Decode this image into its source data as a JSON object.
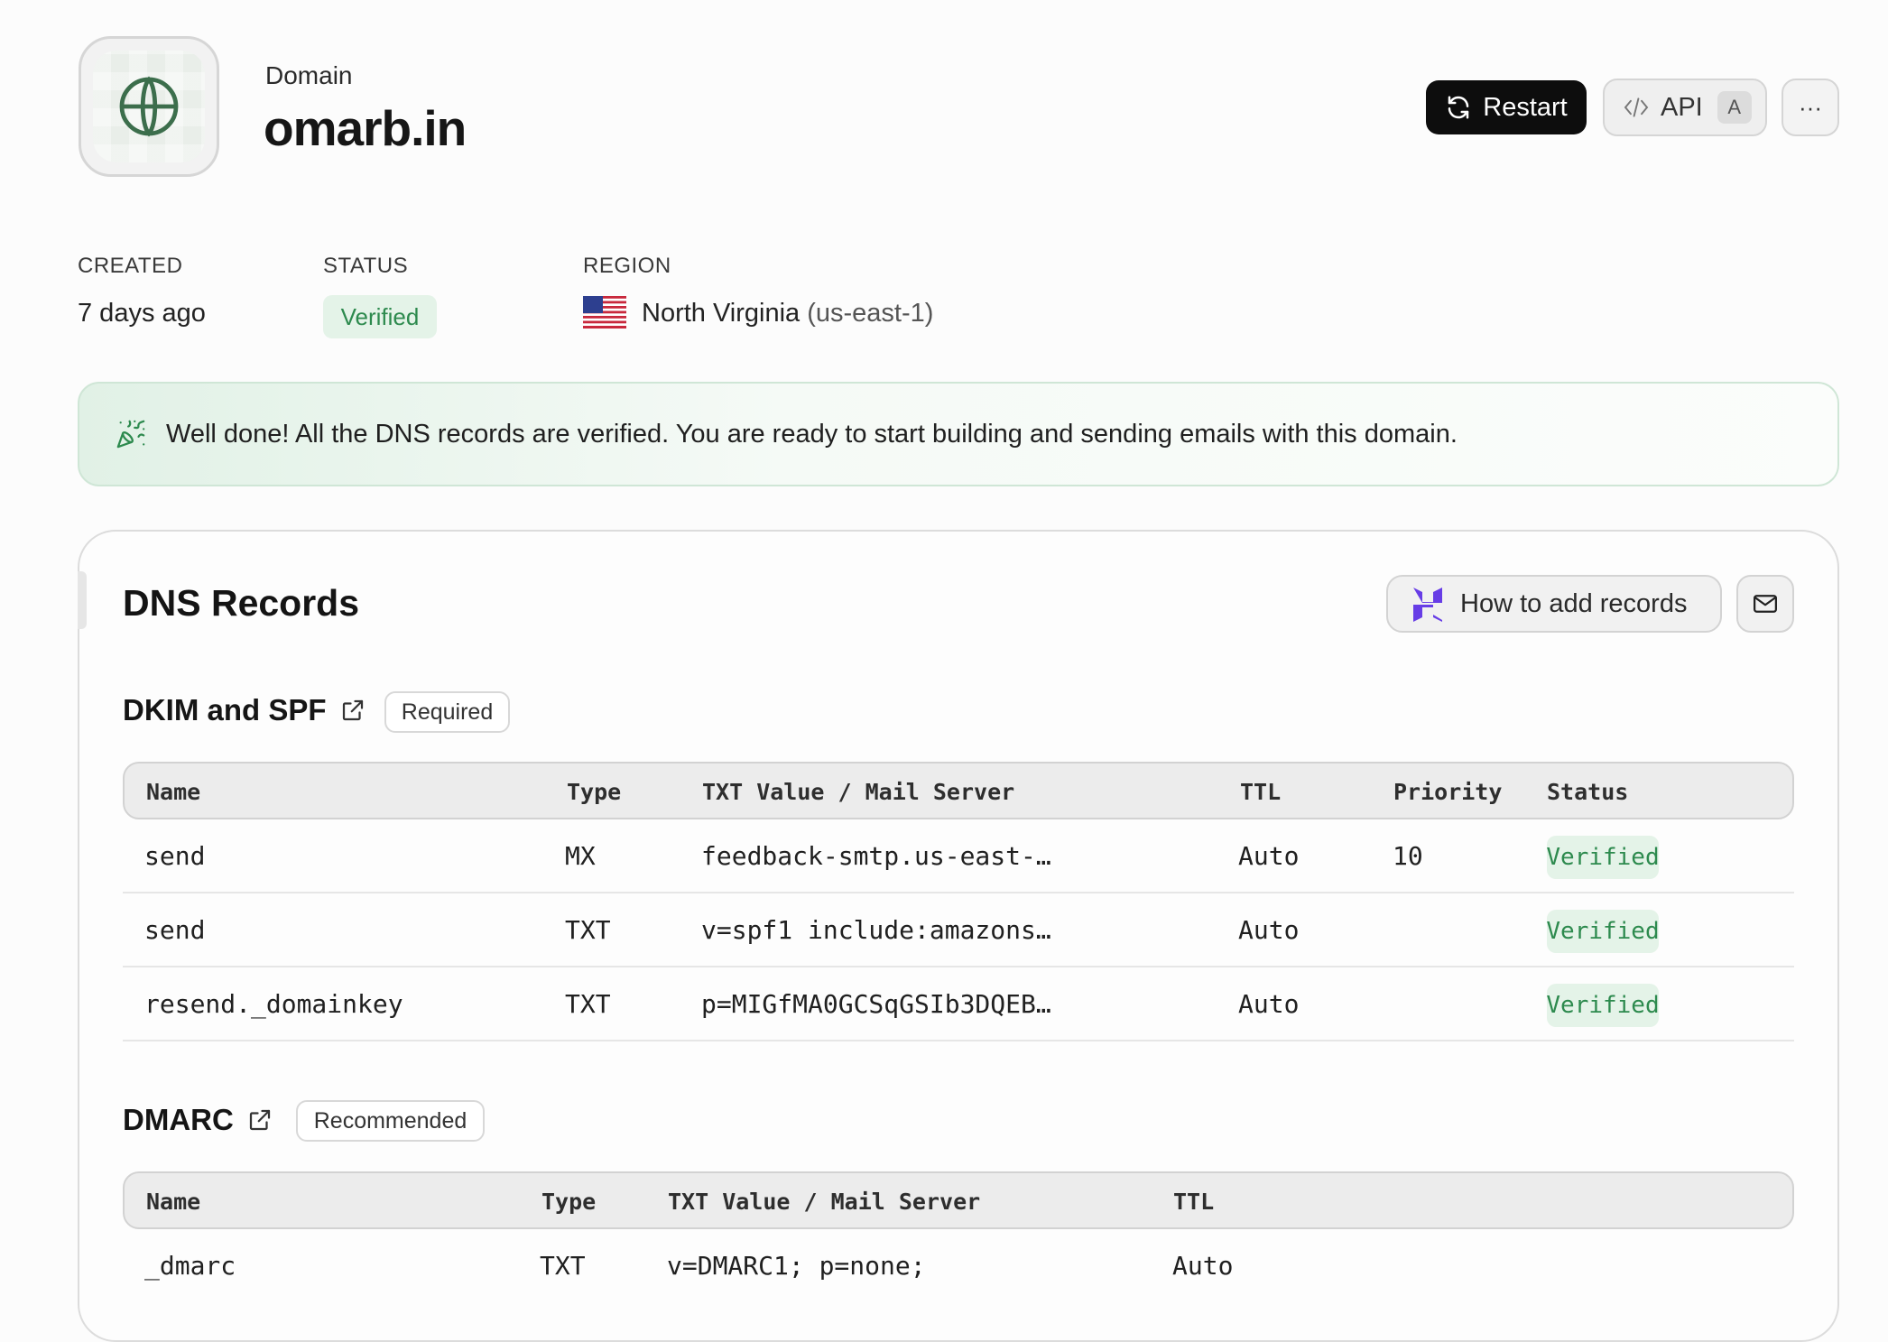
{
  "header": {
    "kicker": "Domain",
    "title": "omarb.in",
    "restart_label": "Restart",
    "api_label": "API",
    "api_shortcut": "A",
    "more_label": "···"
  },
  "meta": {
    "created_label": "CREATED",
    "created_value": "7 days ago",
    "status_label": "STATUS",
    "status_value": "Verified",
    "region_label": "REGION",
    "region_value": "North Virginia",
    "region_code": "(us-east-1)"
  },
  "banner": {
    "icon": "party-popper-icon",
    "text": "Well done! All the DNS records are verified. You are ready to start building and sending emails with this domain."
  },
  "dns": {
    "title": "DNS Records",
    "howto_label": "How to add records",
    "dkim_spf": {
      "title": "DKIM and SPF",
      "tag": "Required",
      "columns": [
        "Name",
        "Type",
        "TXT Value / Mail Server",
        "TTL",
        "Priority",
        "Status"
      ],
      "rows": [
        {
          "name": "send",
          "type": "MX",
          "value": "feedback-smtp.us-east-…",
          "ttl": "Auto",
          "priority": "10",
          "status": "Verified"
        },
        {
          "name": "send",
          "type": "TXT",
          "value": "v=spf1 include:amazons…",
          "ttl": "Auto",
          "priority": "",
          "status": "Verified"
        },
        {
          "name": "resend._domainkey",
          "type": "TXT",
          "value": "p=MIGfMA0GCSqGSIb3DQEB…",
          "ttl": "Auto",
          "priority": "",
          "status": "Verified"
        }
      ]
    },
    "dmarc": {
      "title": "DMARC",
      "tag": "Recommended",
      "columns": [
        "Name",
        "Type",
        "TXT Value / Mail Server",
        "TTL"
      ],
      "rows": [
        {
          "name": "_dmarc",
          "type": "TXT",
          "value": "v=DMARC1; p=none;",
          "ttl": "Auto"
        }
      ]
    }
  },
  "colors": {
    "accent_green": "#2d8a4e",
    "verified_bg": "#e4f3e8",
    "banner_border": "#cfe6d6",
    "primary_button": "#0d0d0d",
    "hostinger_purple": "#673de6"
  }
}
